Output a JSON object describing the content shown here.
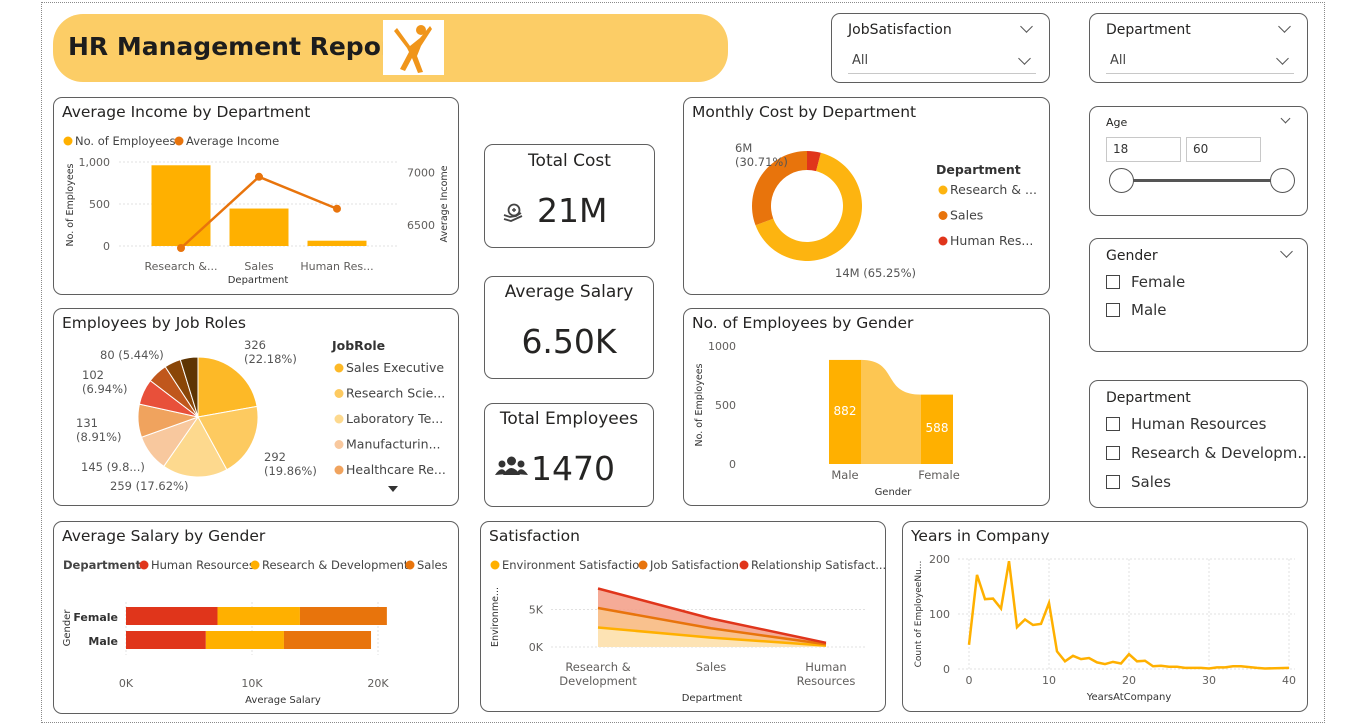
{
  "header": {
    "title": "HR Management Report"
  },
  "colors": {
    "accent_yellow": "#ffb000",
    "accent_orange": "#e8740c",
    "accent_red": "#e04a1b",
    "banner": "#fccd66"
  },
  "kpis": {
    "total_cost": {
      "label": "Total Cost",
      "value": "21M",
      "icon": "money-icon"
    },
    "avg_salary": {
      "label": "Average Salary",
      "value": "6.50K"
    },
    "total_employees": {
      "label": "Total Employees",
      "value": "1470",
      "icon": "people-icon"
    }
  },
  "slicers": {
    "job_satisfaction": {
      "title": "JobSatisfaction",
      "value": "All"
    },
    "department": {
      "title": "Department",
      "value": "All"
    },
    "age": {
      "title": "Age",
      "min": "18",
      "max": "60",
      "range": [
        18,
        60
      ]
    },
    "gender": {
      "title": "Gender",
      "options": [
        "Female",
        "Male"
      ]
    },
    "department_list": {
      "title": "Department",
      "options": [
        "Human Resources",
        "Research & Developm...",
        "Sales"
      ]
    }
  },
  "chart_data": [
    {
      "id": "avg_income",
      "type": "bar",
      "title": "Average Income by Department",
      "legend": [
        "No. of Employees",
        "Average Income"
      ],
      "categories": [
        "Research &...",
        "Sales",
        "Human Res..."
      ],
      "xlabel": "Department",
      "ylabel": "No. of Employees",
      "y2label": "Average Income",
      "yticks": [
        "1,000",
        "500",
        "0"
      ],
      "y2ticks": [
        "7000",
        "6500"
      ],
      "ylim": [
        0,
        1000
      ],
      "y2lim": [
        6300,
        7100
      ],
      "series": [
        {
          "name": "No. of Employees",
          "values": [
            961,
            446,
            63
          ]
        },
        {
          "name": "Average Income",
          "values": [
            6281,
            6959,
            6655
          ]
        }
      ]
    },
    {
      "id": "job_roles",
      "type": "pie",
      "title": "Employees by Job Roles",
      "legend_title": "JobRole",
      "legend": [
        "Sales Executive",
        "Research Scie...",
        "Laboratory Te...",
        "Manufacturin...",
        "Healthcare Re..."
      ],
      "values": [
        326,
        292,
        259,
        145,
        131,
        102,
        80,
        65,
        70
      ],
      "labels": [
        "326\n(22.18%)",
        "292\n(19.86%)",
        "259 (17.62%)",
        "145 (9.8...)",
        "131\n(8.91%)",
        "102\n(6.94%)",
        "80 (5.44%)"
      ],
      "colors": [
        "#fdb927",
        "#fdca60",
        "#fdd98e",
        "#f8c89e",
        "#f0a35e",
        "#e8503a",
        "#c0571c",
        "#8a4608",
        "#5e3504"
      ]
    },
    {
      "id": "monthly_cost",
      "type": "pie",
      "title": "Monthly Cost by Department",
      "legend_title": "Department",
      "legend": [
        "Research & ...",
        "Sales",
        "Human Res..."
      ],
      "values": [
        65.25,
        30.71,
        4.04
      ],
      "labels": [
        "6M\n(30.71%)",
        "14M (65.25%)"
      ],
      "colors": [
        "#fdb410",
        "#e8740c",
        "#e0351b"
      ]
    },
    {
      "id": "gender_count",
      "type": "bar",
      "title": "No. of Employees by Gender",
      "categories": [
        "Male",
        "Female"
      ],
      "values": [
        882,
        588
      ],
      "xlabel": "Gender",
      "ylabel": "No. of Employees",
      "yticks": [
        "1000",
        "500",
        "0"
      ],
      "ylim": [
        0,
        1000
      ]
    },
    {
      "id": "salary_gender",
      "type": "bar",
      "title": "Average Salary by Gender",
      "legend_title": "Department",
      "legend": [
        "Human Resources",
        "Research & Development",
        "Sales"
      ],
      "categories": [
        "Female",
        "Male"
      ],
      "xlabel": "Average Salary",
      "ylabel": "Gender",
      "xticks": [
        "0K",
        "10K",
        "20K"
      ],
      "xlim": [
        0,
        20000
      ],
      "series": [
        {
          "name": "Human Resources",
          "values": [
            7264,
            6336
          ]
        },
        {
          "name": "Research & Development",
          "values": [
            6540,
            6200
          ]
        },
        {
          "name": "Sales",
          "values": [
            6900,
            6910
          ]
        }
      ]
    },
    {
      "id": "satisfaction",
      "type": "area",
      "title": "Satisfaction",
      "legend": [
        "Environment Satisfaction",
        "Job Satisfaction",
        "Relationship Satisfact..."
      ],
      "categories": [
        "Research &\nDevelopment",
        "Sales",
        "Human\nResources"
      ],
      "xlabel": "Department",
      "ylabel": "Environme...",
      "yticks": [
        "5K",
        "0K"
      ],
      "ylim": [
        0,
        8000
      ],
      "series": [
        {
          "name": "Environment Satisfaction",
          "values": [
            2600,
            1250,
            190
          ]
        },
        {
          "name": "Job Satisfaction",
          "values": [
            5200,
            2500,
            370
          ]
        },
        {
          "name": "Relationship Satisfact...",
          "values": [
            7800,
            3800,
            560
          ]
        }
      ]
    },
    {
      "id": "years",
      "type": "line",
      "title": "Years in Company",
      "xlabel": "YearsAtCompany",
      "ylabel": "Count of EmployeeNu...",
      "yticks": [
        "200",
        "100",
        "0"
      ],
      "xticks": [
        "0",
        "10",
        "20",
        "30",
        "40"
      ],
      "ylim": [
        0,
        200
      ],
      "xlim": [
        0,
        40
      ],
      "x": [
        0,
        1,
        2,
        3,
        4,
        5,
        6,
        7,
        8,
        9,
        10,
        11,
        12,
        13,
        14,
        15,
        16,
        17,
        18,
        19,
        20,
        21,
        22,
        23,
        24,
        25,
        26,
        27,
        29,
        30,
        31,
        32,
        33,
        34,
        36,
        37,
        40
      ],
      "values": [
        44,
        171,
        127,
        128,
        110,
        196,
        76,
        90,
        80,
        82,
        120,
        32,
        14,
        24,
        18,
        20,
        12,
        9,
        13,
        10,
        27,
        14,
        15,
        5,
        6,
        4,
        4,
        2,
        2,
        1,
        3,
        3,
        5,
        5,
        2,
        1,
        2
      ]
    }
  ]
}
